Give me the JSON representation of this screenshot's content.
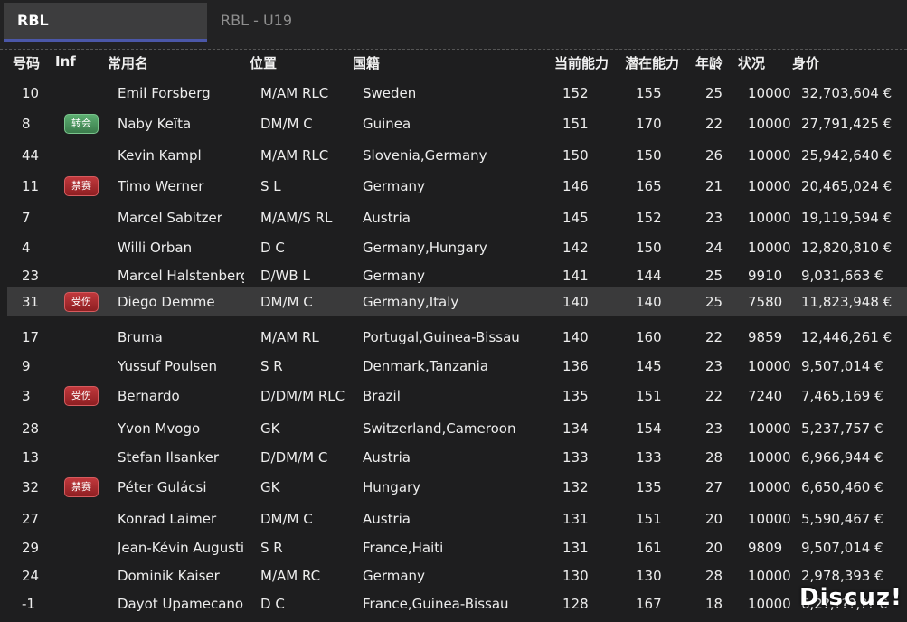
{
  "tabs": [
    {
      "label": "RBL",
      "active": true
    },
    {
      "label": "RBL - U19",
      "active": false
    }
  ],
  "columns": {
    "number": "号码",
    "inf": "Inf",
    "name": "常用名",
    "position": "位置",
    "nationality": "国籍",
    "current_ability": "当前能力",
    "potential_ability": "潜在能力",
    "age": "年龄",
    "condition": "状况",
    "value": "身价"
  },
  "players": [
    {
      "number": "10",
      "inf": "",
      "name": "Emil Forsberg",
      "position": "M/AM RLC",
      "nationality": "Sweden",
      "ca": "152",
      "pa": "155",
      "age": "25",
      "condition": "10000",
      "value": "32,703,604 €"
    },
    {
      "number": "8",
      "inf": "转会",
      "inf_color": "green",
      "name": "Naby Keïta",
      "position": "DM/M C",
      "nationality": "Guinea",
      "ca": "151",
      "pa": "170",
      "age": "22",
      "condition": "10000",
      "value": "27,791,425 €"
    },
    {
      "number": "44",
      "inf": "",
      "name": "Kevin Kampl",
      "position": "M/AM RLC",
      "nationality": "Slovenia,Germany",
      "ca": "150",
      "pa": "150",
      "age": "26",
      "condition": "10000",
      "value": "25,942,640 €"
    },
    {
      "number": "11",
      "inf": "禁赛",
      "inf_color": "red",
      "name": "Timo Werner",
      "position": "S L",
      "nationality": "Germany",
      "ca": "146",
      "pa": "165",
      "age": "21",
      "condition": "10000",
      "value": "20,465,024 €"
    },
    {
      "number": "7",
      "inf": "",
      "name": "Marcel Sabitzer",
      "position": "M/AM/S RL",
      "nationality": "Austria",
      "ca": "145",
      "pa": "152",
      "age": "23",
      "condition": "10000",
      "value": "19,119,594 €"
    },
    {
      "number": "4",
      "inf": "",
      "name": "Willi Orban",
      "position": "D C",
      "nationality": "Germany,Hungary",
      "ca": "142",
      "pa": "150",
      "age": "24",
      "condition": "10000",
      "value": "12,820,810 €"
    },
    {
      "number": "23",
      "inf": "",
      "name": "Marcel Halstenberg",
      "position": "D/WB L",
      "nationality": "Germany",
      "ca": "141",
      "pa": "144",
      "age": "25",
      "condition": "9910",
      "value": "9,031,663 €"
    },
    {
      "number": "31",
      "inf": "受伤",
      "inf_color": "red",
      "name": "Diego Demme",
      "position": "DM/M C",
      "nationality": "Germany,Italy",
      "ca": "140",
      "pa": "140",
      "age": "25",
      "condition": "7580",
      "value": "11,823,948 €",
      "selected": true
    },
    {
      "number": "17",
      "inf": "",
      "name": "Bruma",
      "position": "M/AM RL",
      "nationality": "Portugal,Guinea-Bissau",
      "ca": "140",
      "pa": "160",
      "age": "22",
      "condition": "9859",
      "value": "12,446,261 €"
    },
    {
      "number": "9",
      "inf": "",
      "name": "Yussuf Poulsen",
      "position": "S R",
      "nationality": "Denmark,Tanzania",
      "ca": "136",
      "pa": "145",
      "age": "23",
      "condition": "10000",
      "value": "9,507,014 €"
    },
    {
      "number": "3",
      "inf": "受伤",
      "inf_color": "red",
      "name": "Bernardo",
      "position": "D/DM/M RLC",
      "nationality": "Brazil",
      "ca": "135",
      "pa": "151",
      "age": "22",
      "condition": "7240",
      "value": "7,465,169 €"
    },
    {
      "number": "28",
      "inf": "",
      "name": "Yvon Mvogo",
      "position": "GK",
      "nationality": "Switzerland,Cameroon",
      "ca": "134",
      "pa": "154",
      "age": "23",
      "condition": "10000",
      "value": "5,237,757 €"
    },
    {
      "number": "13",
      "inf": "",
      "name": "Stefan Ilsanker",
      "position": "D/DM/M C",
      "nationality": "Austria",
      "ca": "133",
      "pa": "133",
      "age": "28",
      "condition": "10000",
      "value": "6,966,944 €"
    },
    {
      "number": "32",
      "inf": "禁赛",
      "inf_color": "red",
      "name": "Péter Gulácsi",
      "position": "GK",
      "nationality": "Hungary",
      "ca": "132",
      "pa": "135",
      "age": "27",
      "condition": "10000",
      "value": "6,650,460 €"
    },
    {
      "number": "27",
      "inf": "",
      "name": "Konrad Laimer",
      "position": "DM/M C",
      "nationality": "Austria",
      "ca": "131",
      "pa": "151",
      "age": "20",
      "condition": "10000",
      "value": "5,590,467 €"
    },
    {
      "number": "29",
      "inf": "",
      "name": "Jean-Kévin Augustin",
      "position": "S R",
      "nationality": "France,Haiti",
      "ca": "131",
      "pa": "161",
      "age": "20",
      "condition": "9809",
      "value": "9,507,014 €"
    },
    {
      "number": "24",
      "inf": "",
      "name": "Dominik Kaiser",
      "position": "M/AM RC",
      "nationality": "Germany",
      "ca": "130",
      "pa": "130",
      "age": "28",
      "condition": "10000",
      "value": "2,978,393 €"
    },
    {
      "number": "-1",
      "inf": "",
      "name": "Dayot Upamecano",
      "position": "D C",
      "nationality": "France,Guinea-Bissau",
      "ca": "128",
      "pa": "167",
      "age": "18",
      "condition": "10000",
      "value": "6,2?,???,?? €"
    }
  ],
  "watermark": "Discuz!"
}
